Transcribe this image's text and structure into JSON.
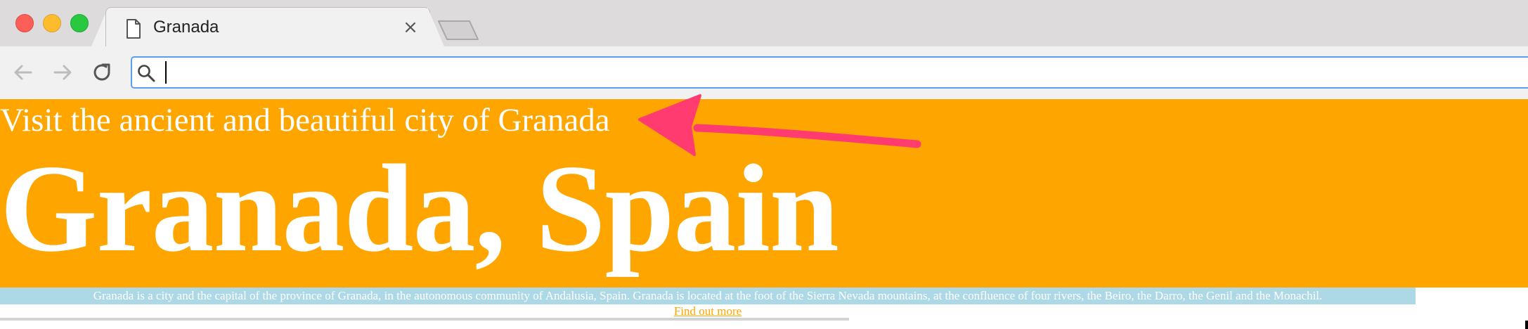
{
  "browser": {
    "tab_title": "Granada",
    "tab_close_glyph": "×",
    "icons": {
      "tab": "document-icon",
      "close": "close-icon",
      "new_tab": "new-tab-icon",
      "back": "arrow-left-icon",
      "forward": "arrow-right-icon",
      "reload": "reload-icon",
      "search": "search-icon"
    },
    "address_bar": {
      "value": "",
      "placeholder": ""
    },
    "window_controls": {
      "close_color": "#fc5f57",
      "minimize_color": "#fdbc2e",
      "maximize_color": "#28c840"
    },
    "focus_color": "#5c9ded"
  },
  "page": {
    "tagline": "Visit the ancient and beautiful city of Granada",
    "title": "Granada, Spain",
    "description": "Granada is a city and the capital of the province of Granada, in the autonomous community of Andalusia, Spain. Granada is located at the foot of the Sierra Nevada mountains, at the confluence of four rivers, the Beiro, the Darro, the Genil and the Monachil.",
    "link_label": "Find out more",
    "colors": {
      "hero_background": "#ffa500",
      "description_background": "#add8e6",
      "link": "#ffa500",
      "text": "#ffffff",
      "divider": "#d3d3d3"
    }
  },
  "annotation": {
    "arrow_color": "#ff3b6f",
    "arrow_icon": "arrow-pointer-icon"
  }
}
